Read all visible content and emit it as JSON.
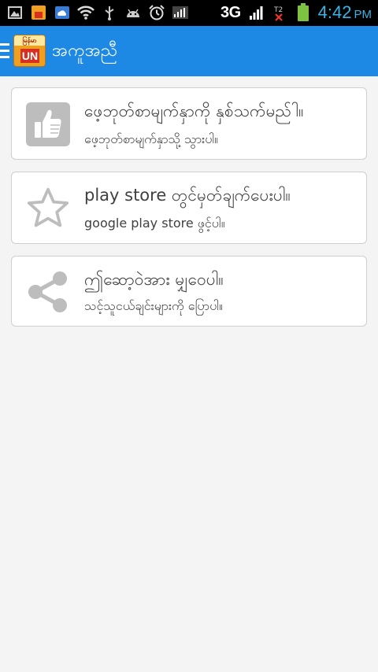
{
  "status_bar": {
    "network": "3G",
    "time": "4:42",
    "ampm": "PM"
  },
  "action_bar": {
    "logo_top": "မြန်မာ",
    "logo_bottom": "UN",
    "title": "အကူအညီ"
  },
  "cards": [
    {
      "icon": "thumbs-up-icon",
      "title": "ဖေ့ဘုတ်စာမျက်နှာကို နှစ်သက်မည်ါ။",
      "subtitle": "ဖေ့ဘုတ်စာမျက်နှာသို့ သွားပါ။"
    },
    {
      "icon": "star-icon",
      "title": "play store တွင်မှတ်ချက်ပေးပါ။",
      "subtitle": "google play store ဖွင့်ပါ။"
    },
    {
      "icon": "share-icon",
      "title": "ဤဆော့ဝဲအား မျှဝေပါ။",
      "subtitle": "သင့်သူငယ်ချင်းများကို ပြောပါ။"
    }
  ],
  "colors": {
    "action_bar": "#1e88e5",
    "status_bar": "#000000",
    "clock": "#35b5e5",
    "icon_gray": "#bdbdbd",
    "background": "#f4f4f4"
  }
}
